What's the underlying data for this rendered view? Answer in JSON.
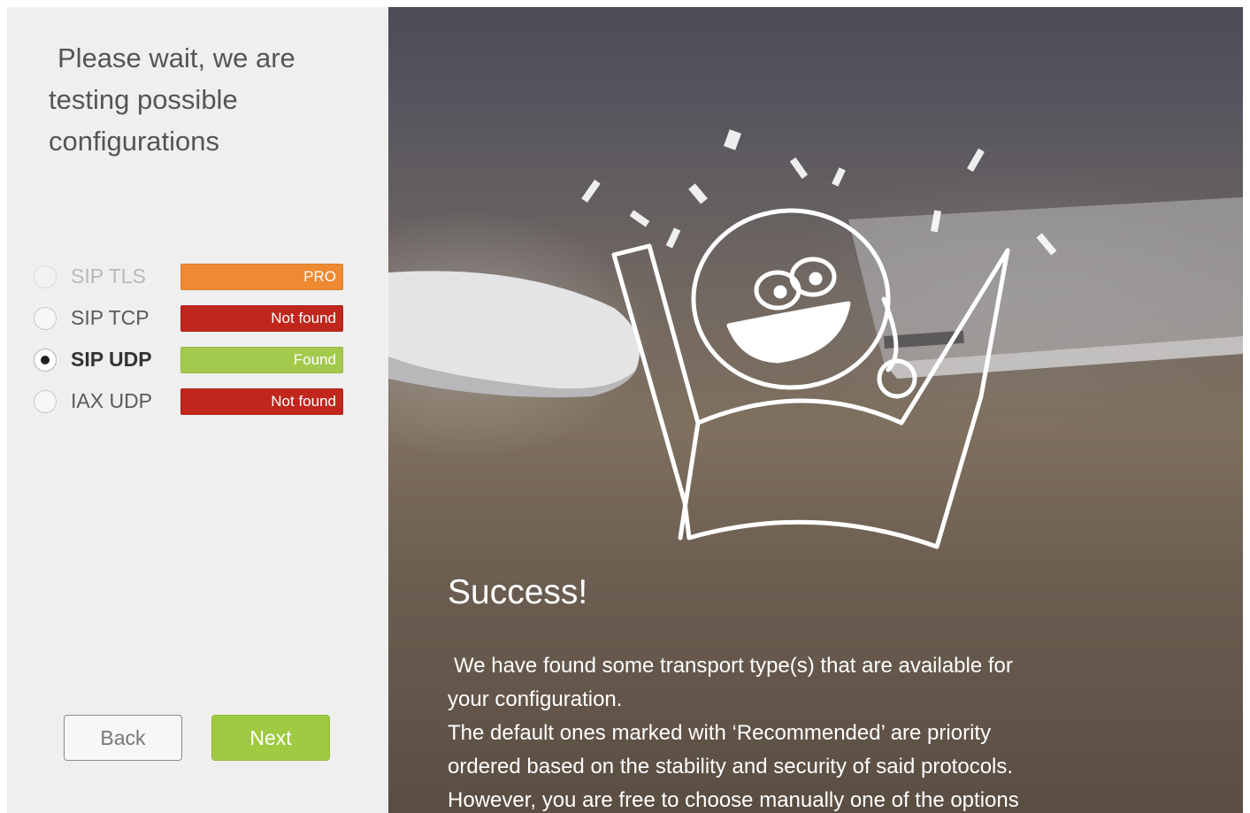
{
  "left": {
    "title_lines": [
      "Please wait, we are",
      "testing possible",
      "configurations"
    ],
    "options": [
      {
        "label": "SIP TLS",
        "status": "PRO",
        "status_color": "#ee8a32",
        "state": "disabled"
      },
      {
        "label": "SIP TCP",
        "status": "Not found",
        "status_color": "#c0261c",
        "state": "unchecked"
      },
      {
        "label": "SIP UDP",
        "status": "Found",
        "status_color": "#a3c94c",
        "state": "checked"
      },
      {
        "label": "IAX UDP",
        "status": "Not found",
        "status_color": "#c0261c",
        "state": "unchecked"
      }
    ],
    "back_label": "Back",
    "next_label": "Next"
  },
  "right": {
    "success_title": "Success!",
    "body_lines": [
      "We have found some transport type(s) that are available for",
      "your configuration.",
      "The default ones marked with ‘Recommended’ are priority",
      "ordered based on the stability and security of said protocols.",
      "However, you are free to choose manually one of the options"
    ]
  },
  "colors": {
    "next_button": "#9fca42",
    "left_panel_bg": "#efefef"
  },
  "icons": {
    "illustration": "celebrating-character-icon"
  }
}
